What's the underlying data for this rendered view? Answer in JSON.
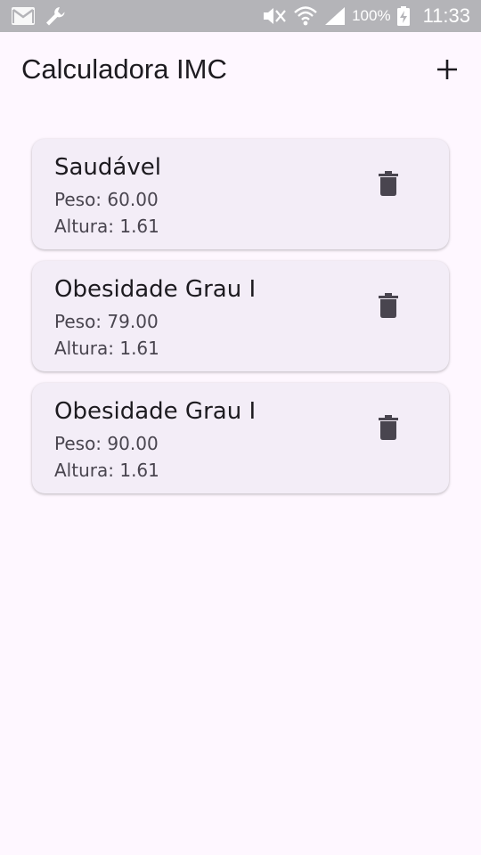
{
  "status_bar": {
    "battery_text": "100%",
    "time": "11:33",
    "icons": [
      "gmail-icon",
      "wrench-icon",
      "mute-icon",
      "wifi-icon",
      "signal-icon",
      "battery-charging-icon"
    ]
  },
  "app_bar": {
    "title": "Calculadora IMC",
    "add_icon": "plus-icon"
  },
  "records": [
    {
      "title": "Saudável",
      "peso_label": "Peso:",
      "peso": "60.00",
      "altura_label": "Altura:",
      "altura": "1.61"
    },
    {
      "title": "Obesidade Grau I",
      "peso_label": "Peso:",
      "peso": "79.00",
      "altura_label": "Altura:",
      "altura": "1.61"
    },
    {
      "title": "Obesidade Grau I",
      "peso_label": "Peso:",
      "peso": "90.00",
      "altura_label": "Altura:",
      "altura": "1.61"
    }
  ],
  "colors": {
    "background": "#fef7ff",
    "card": "#f3edf7",
    "title_text": "#1d1b20",
    "secondary_text": "#49454f",
    "icon": "#49454f",
    "status_bar": "#b4b4b8"
  }
}
